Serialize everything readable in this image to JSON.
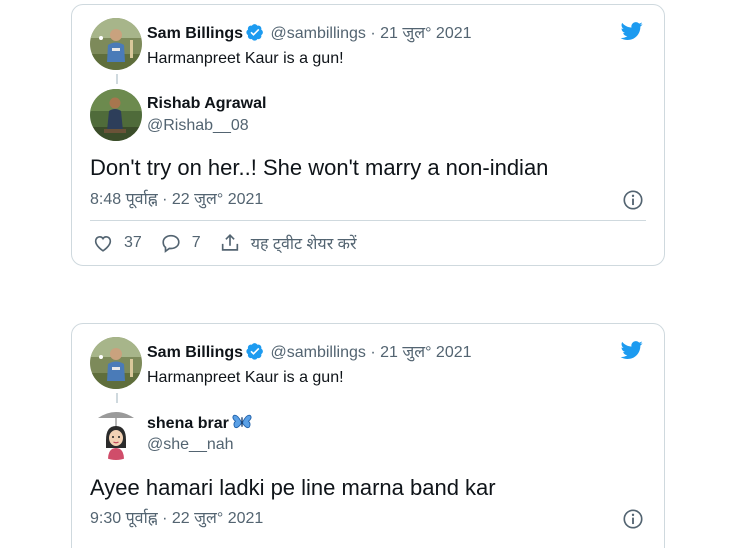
{
  "cards": [
    {
      "parent": {
        "name": "Sam Billings",
        "handle": "@sambillings",
        "separator": "·",
        "date": "21 जुल° 2021",
        "text": "Harmanpreet Kaur is a gun!"
      },
      "reply": {
        "name": "Rishab Agrawal",
        "handle": "@Rishab__08",
        "text": "Don't try on her..! She won't marry a non-indian",
        "timestamp": "8:48 पूर्वाह्न · 22 जुल° 2021"
      },
      "actions": {
        "like_count": "37",
        "reply_count": "7",
        "share_label": "यह ट्वीट शेयर करें"
      }
    },
    {
      "parent": {
        "name": "Sam Billings",
        "handle": "@sambillings",
        "separator": "·",
        "date": "21 जुल° 2021",
        "text": "Harmanpreet Kaur is a gun!"
      },
      "reply": {
        "name": "shena brar",
        "handle": "@she__nah",
        "text": "Ayee hamari ladki pe line marna band kar",
        "timestamp": "9:30 पूर्वाह्न · 22 जुल° 2021"
      }
    }
  ],
  "icons": {
    "brand": "twitter-bird-icon",
    "verified": "verified-badge-icon",
    "info": "info-icon",
    "like": "heart-icon",
    "reply": "reply-bubble-icon",
    "share": "share-upload-icon",
    "emoji": "butterfly-emoji-icon"
  },
  "colors": {
    "twitter_blue": "#1d9bf0",
    "text_primary": "#0f1419",
    "text_secondary": "#536471",
    "border": "#cfd9de"
  }
}
